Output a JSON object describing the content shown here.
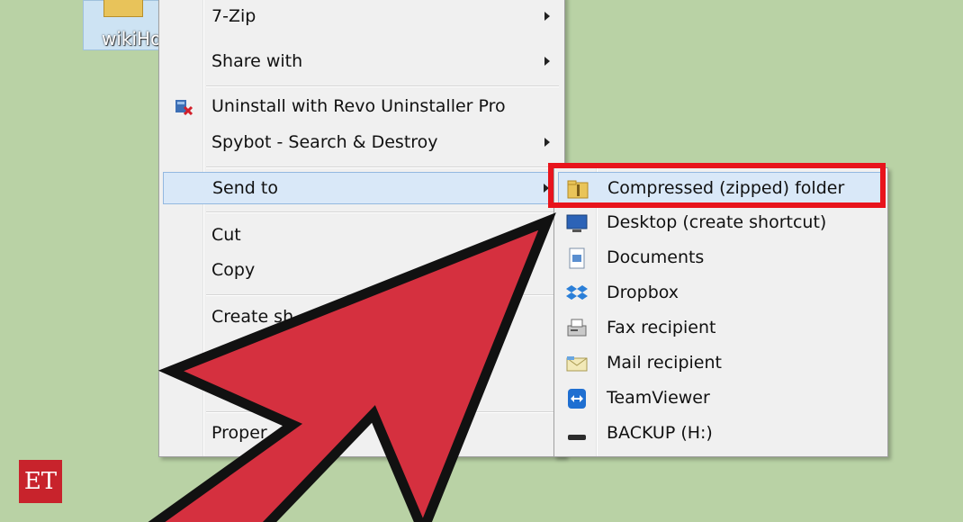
{
  "desktop": {
    "icon_label": "wikiHo"
  },
  "context_menu": {
    "items": [
      {
        "label": "7-Zip",
        "submenu": true
      },
      {
        "label": "Share with",
        "submenu": true
      },
      {
        "label": "Uninstall with Revo Uninstaller Pro",
        "submenu": false,
        "icon": "revo-uninstaller-icon"
      },
      {
        "label": "Spybot - Search & Destroy",
        "submenu": true
      },
      {
        "label": "Send to",
        "submenu": true,
        "highlighted": true
      },
      {
        "label": "Cut",
        "submenu": false
      },
      {
        "label": "Copy",
        "submenu": false
      },
      {
        "label": "Create sh",
        "submenu": false
      },
      {
        "label": "Proper",
        "submenu": false
      }
    ]
  },
  "send_to_menu": {
    "items": [
      {
        "label": "Compressed (zipped) folder",
        "icon": "zip-folder-icon",
        "highlighted": true
      },
      {
        "label": "Desktop (create shortcut)",
        "icon": "desktop-icon"
      },
      {
        "label": "Documents",
        "icon": "documents-icon"
      },
      {
        "label": "Dropbox",
        "icon": "dropbox-icon"
      },
      {
        "label": "Fax recipient",
        "icon": "fax-icon"
      },
      {
        "label": "Mail recipient",
        "icon": "mail-icon"
      },
      {
        "label": "TeamViewer",
        "icon": "teamviewer-icon"
      },
      {
        "label": "BACKUP (H:)",
        "icon": "drive-icon"
      }
    ]
  },
  "annotation": {
    "box_color": "#e8141c",
    "arrow_color": "#d5303f",
    "arrow_outline": "#111111"
  },
  "watermark": {
    "text": "ET"
  }
}
